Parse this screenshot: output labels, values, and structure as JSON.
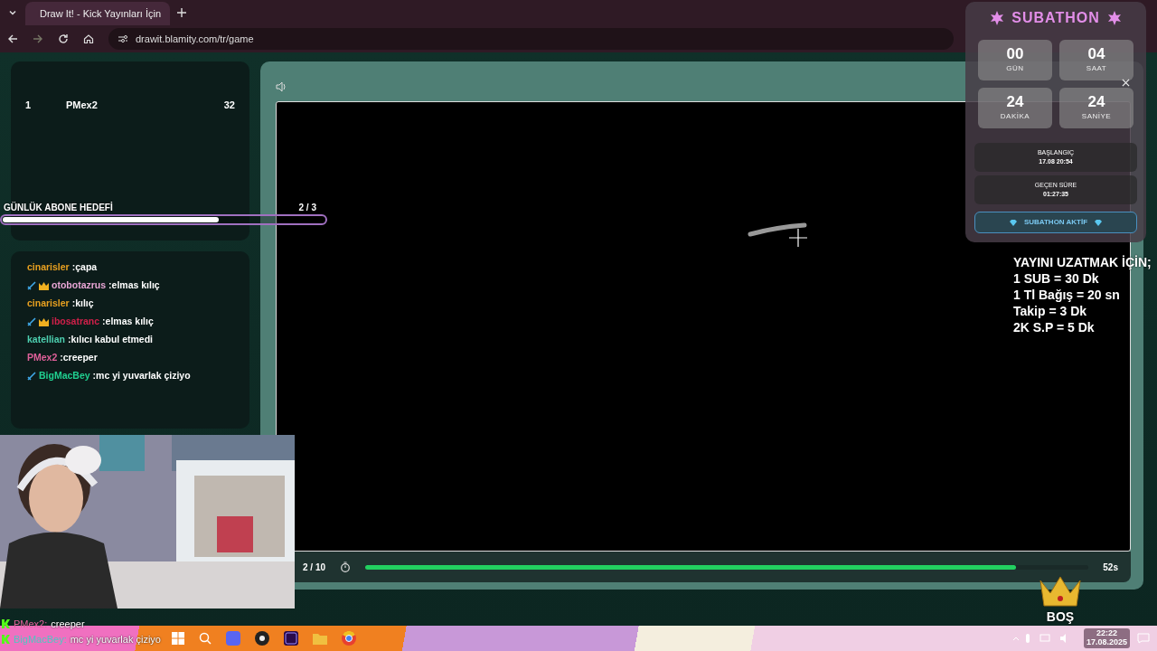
{
  "browser": {
    "tab_title": "Draw It! - Kick Yayınları İçin",
    "url": "drawit.blamity.com/tr/game"
  },
  "leaderboard": [
    {
      "rank": "1",
      "name": "PMex2",
      "score": "32"
    }
  ],
  "goal": {
    "label": "GÜNLÜK ABONE HEDEFİ",
    "count": "2 / 3",
    "level": 0.67
  },
  "chat": [
    {
      "user": "cinarisler",
      "color": "#e8a020",
      "sword_badge": false,
      "crown_badge": false,
      "text": ":çapa"
    },
    {
      "user": "otobotazrus",
      "color": "#e9a6d6",
      "sword_badge": true,
      "crown_badge": true,
      "text": ":elmas kılıç"
    },
    {
      "user": "cinarisler",
      "color": "#e8a020",
      "sword_badge": false,
      "crown_badge": false,
      "text": ":kılıç"
    },
    {
      "user": "ibosatranc",
      "color": "#d0204a",
      "sword_badge": true,
      "crown_badge": true,
      "text": ":elmas kılıç"
    },
    {
      "user": "katellian",
      "color": "#4dd0b0",
      "sword_badge": false,
      "crown_badge": false,
      "text": ":kılıcı kabul etmedi"
    },
    {
      "user": "PMex2",
      "color": "#e0609a",
      "sword_badge": false,
      "crown_badge": false,
      "text": ":creeper"
    },
    {
      "user": "BigMacBey",
      "color": "#20d090",
      "sword_badge": true,
      "crown_badge": false,
      "text": ":mc yi yuvarlak çiziyo"
    }
  ],
  "game": {
    "round": "2 / 10",
    "time": "52s",
    "level": 0.9
  },
  "subathon": {
    "title": "SUBATHON",
    "timers": [
      {
        "value": "00",
        "label": "GÜN"
      },
      {
        "value": "04",
        "label": "SAAT"
      },
      {
        "value": "24",
        "label": "DAKİKA"
      },
      {
        "value": "24",
        "label": "SANİYE"
      }
    ],
    "info": [
      {
        "label": "BAŞLANGIÇ",
        "value": "17.08 20:54"
      },
      {
        "label": "GEÇEN SÜRE",
        "value": "01:27:35"
      }
    ],
    "status": "SUBATHON AKTİF"
  },
  "overlay_text": [
    "YAYINI UZATMAK İÇİN;",
    "1 SUB = 30 Dk",
    "1 Tl Bağış = 20 sn",
    "Takip = 3 Dk",
    "2K S.P = 5 Dk"
  ],
  "crown_label": "BOŞ",
  "stream_chat": [
    {
      "user": "PMex2:",
      "color": "#e0609a",
      "text": "creeper"
    },
    {
      "user": "BigMacBey:",
      "color": "#4dc8c0",
      "text": "mc yi yuvarlak çiziyo"
    }
  ],
  "clock": {
    "time": "22:22",
    "date": "17.08.2025"
  }
}
